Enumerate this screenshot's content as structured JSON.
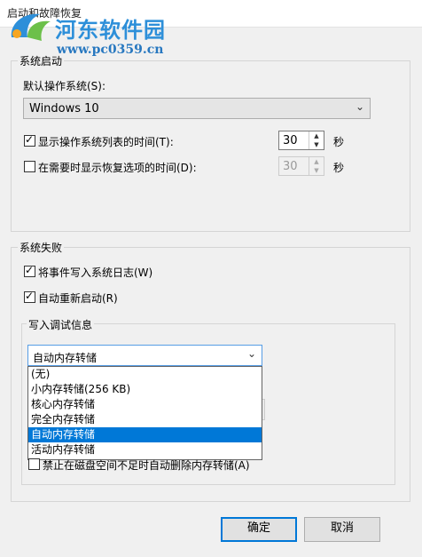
{
  "window": {
    "title": "启动和故障恢复"
  },
  "watermark": {
    "brand": "河东软件园",
    "url": "www.pc0359.cn"
  },
  "system_startup": {
    "legend": "系统启动",
    "default_os_label": "默认操作系统(S):",
    "default_os_value": "Windows 10",
    "show_os_list_label": "显示操作系统列表的时间(T):",
    "show_os_list_checked": true,
    "show_os_list_value": "30",
    "show_recovery_label": "在需要时显示恢复选项的时间(D):",
    "show_recovery_checked": false,
    "show_recovery_value": "30",
    "seconds_unit": "秒"
  },
  "system_failure": {
    "legend": "系统失败",
    "write_event_label": "将事件写入系统日志(W)",
    "write_event_checked": true,
    "auto_restart_label": "自动重新启动(R)",
    "auto_restart_checked": true
  },
  "debug_info": {
    "legend": "写入调试信息",
    "selected": "自动内存转储",
    "options": [
      "(无)",
      "小内存转储(256 KB)",
      "核心内存转储",
      "完全内存转储",
      "自动内存转储",
      "活动内存转储"
    ],
    "highlighted_index": 4,
    "disable_paging_label": "禁止在磁盘空间不足时自动删除内存转储(A)",
    "disable_paging_checked": false
  },
  "buttons": {
    "ok": "确定",
    "cancel": "取消"
  },
  "colors": {
    "accent": "#0078d7",
    "brand": "#2d8fd9"
  }
}
